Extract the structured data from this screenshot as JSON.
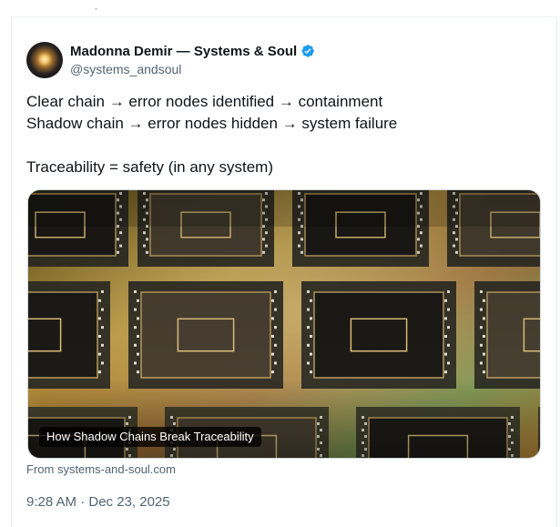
{
  "author": {
    "display_name": "Madonna Demir — Systems & Soul",
    "handle": "@systems_andsoul",
    "verified": true,
    "avatar_icon": "avatar-image"
  },
  "tweet": {
    "lines": [
      "Clear chain → error nodes identified → containment",
      "Shadow chain → error nodes hidden → system failure",
      "",
      "Traceability = safety (in any system)"
    ]
  },
  "link_card": {
    "title": "How Shadow Chains Break Traceability",
    "source": "From systems-and-soul.com"
  },
  "meta": {
    "timestamp": "9:28 AM · Dec 23, 2025"
  },
  "colors": {
    "verified_blue": "#1d9bf0",
    "secondary_text": "#536471"
  }
}
